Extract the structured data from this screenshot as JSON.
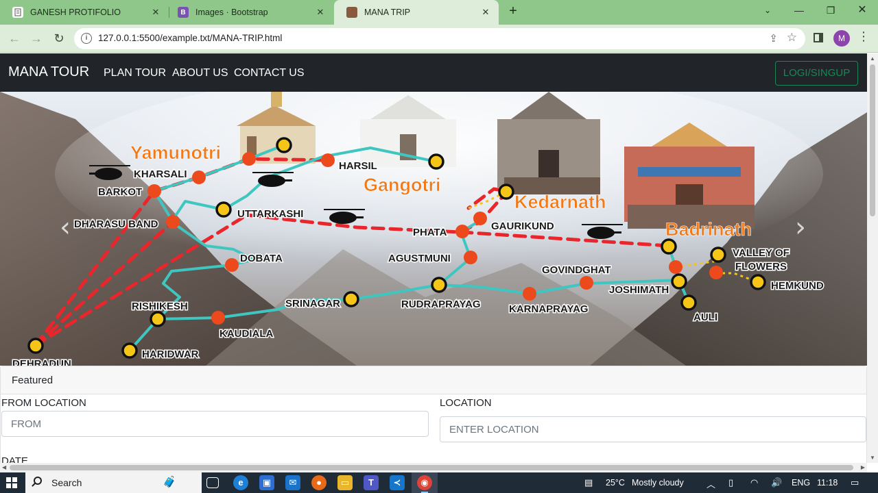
{
  "browser": {
    "tabs": [
      {
        "title": "GANESH PROTIFOLIO",
        "favicon_color": "#ffffff",
        "active": false
      },
      {
        "title": "Images · Bootstrap",
        "favicon_color": "#7952b3",
        "favicon_letter": "B",
        "active": false
      },
      {
        "title": "MANA TRIP",
        "favicon_color": "#8a5a3c",
        "active": true
      }
    ],
    "url": "127.0.0.1:5500/example.txt/MANA-TRIP.html",
    "profile_initial": "M",
    "theme_color": "#8fc78a"
  },
  "site": {
    "brand": "MANA TOUR",
    "nav": [
      "PLAN TOUR",
      "ABOUT US",
      "CONTACT US"
    ],
    "login_label": "LOGI/SINGUP",
    "login_color": "#198754"
  },
  "carousel": {
    "prev_glyph": "‹",
    "next_glyph": "›",
    "dhams": [
      "Yamunotri",
      "Gangotri",
      "Kedarnath",
      "Badrinath"
    ],
    "places": [
      "KHARSALI",
      "BARKOT",
      "DHARASU BAND",
      "UTTARKASHI",
      "HARSIL",
      "DOBATA",
      "RISHIKESH",
      "KAUDIALA",
      "HARIDWAR",
      "SRINAGAR",
      "RUDRAPRAYAG",
      "AGUSTMUNI",
      "PHATA",
      "GAURIKUND",
      "GOVINDGHAT",
      "KARNAPRAYAG",
      "JOSHIMATH",
      "AULI",
      "VALLEY OF",
      "FLOWERS",
      "HEMKUND",
      "DEHRADUN"
    ],
    "route_color": "#3fc6c0",
    "heli_color": "#e8262b",
    "dham_color": "#f07a1a"
  },
  "card": {
    "header": "Featured",
    "from_label": "FROM LOCATION",
    "from_placeholder": "FROM",
    "to_label": "LOCATION",
    "to_placeholder": "ENTER LOCATION",
    "date_label": "DATE"
  },
  "taskbar": {
    "search_text": "Search",
    "weather": "25°C",
    "weather_desc": "Mostly cloudy",
    "lang": "ENG",
    "time": "11:18"
  }
}
